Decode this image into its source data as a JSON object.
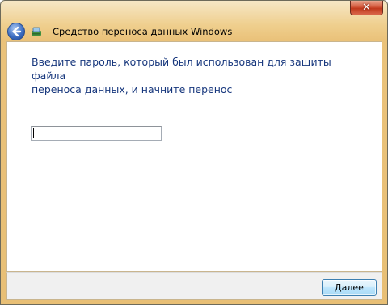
{
  "window": {
    "title": "Средство переноса данных Windows",
    "close_label": "✕"
  },
  "icons": {
    "back": "back-arrow-icon",
    "app": "easy-transfer-icon",
    "close": "close-icon"
  },
  "main": {
    "instruction_line1": "Введите пароль, который был использован для защиты файла",
    "instruction_line2": "переноса данных, и начните перенос",
    "password": {
      "value": "",
      "placeholder": ""
    }
  },
  "footer": {
    "next_label": "Далее"
  },
  "colors": {
    "instruction_text": "#17377d",
    "title_bar": "#efcf8e",
    "content_bg": "#ffffff",
    "footer_bg": "#f0f0f0"
  }
}
